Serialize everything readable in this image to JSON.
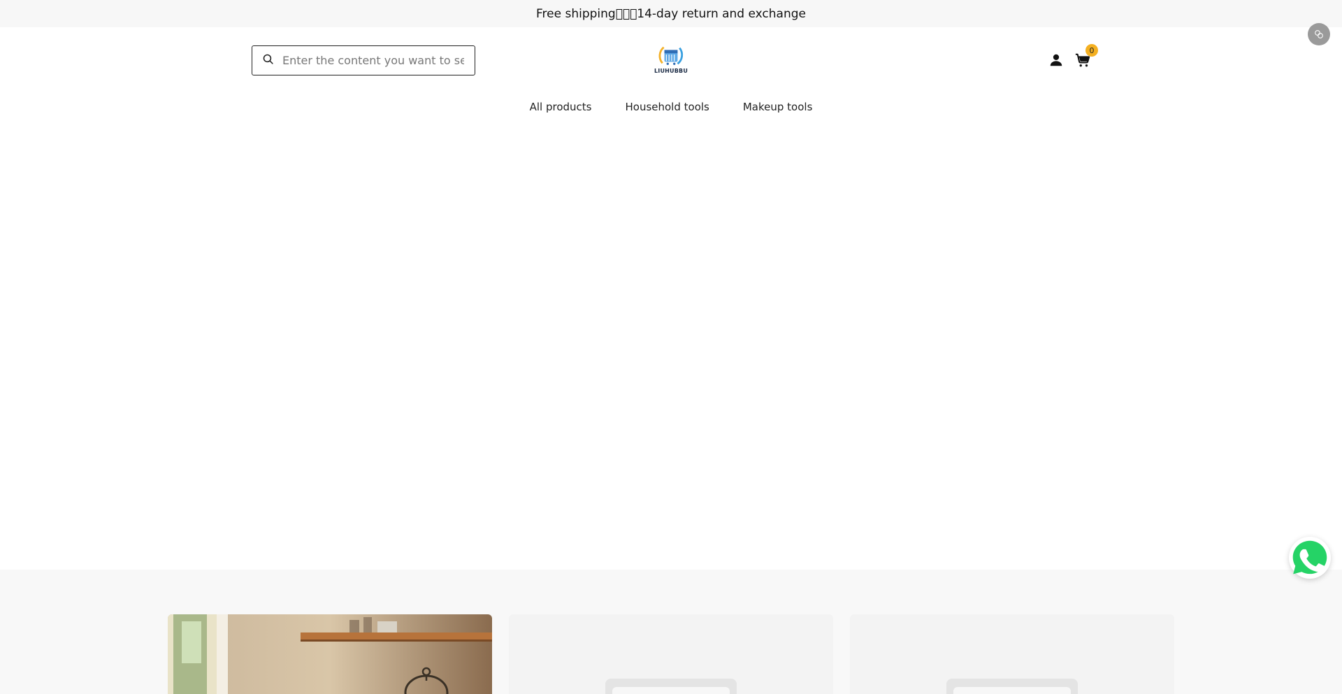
{
  "announcement": "Free shipping\u0000\u0000\u000014-day return and exchange",
  "search": {
    "placeholder": "Enter the content you want to search"
  },
  "logo": {
    "text": "LIUHUBBU"
  },
  "cart": {
    "count": "0"
  },
  "nav": {
    "items": [
      "All products",
      "Household tools",
      "Makeup tools"
    ]
  },
  "colors": {
    "badge": "#f4b021",
    "announcement_bg": "#f7f7f7",
    "whatsapp": "#25d366"
  },
  "icons": [
    "search-icon",
    "account-icon",
    "cart-icon",
    "whatsapp-icon",
    "translate-icon"
  ]
}
